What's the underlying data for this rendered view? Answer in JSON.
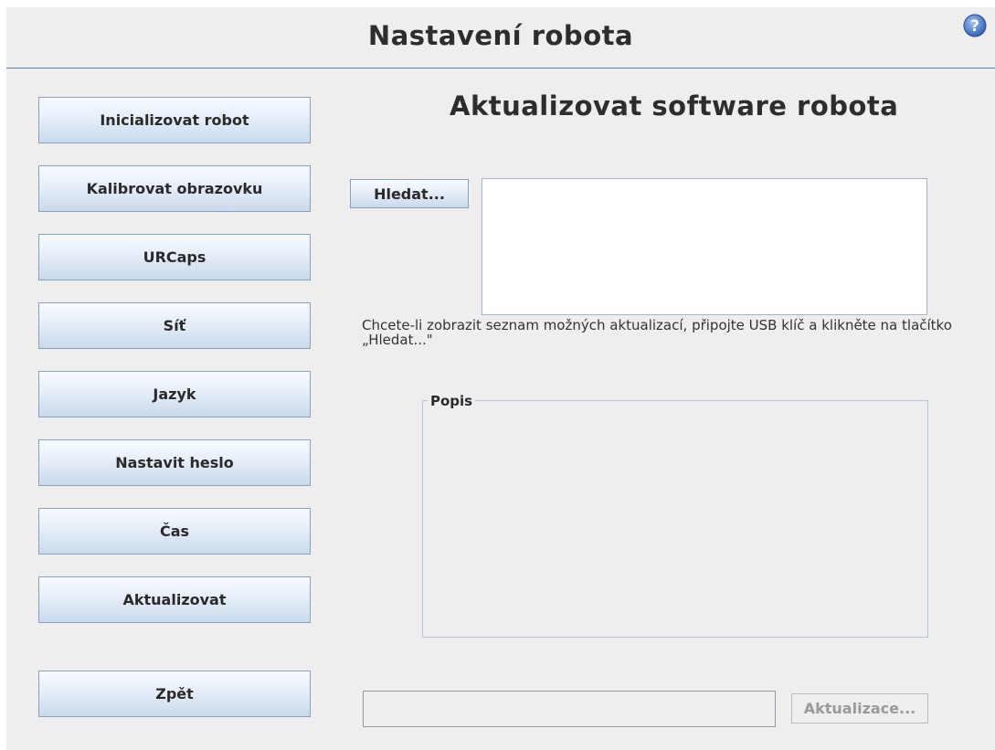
{
  "header": {
    "title": "Nastavení robota",
    "help_icon": "question-circle-icon"
  },
  "sidebar": {
    "items": [
      {
        "label": "Inicializovat robot"
      },
      {
        "label": "Kalibrovat obrazovku"
      },
      {
        "label": "URCaps"
      },
      {
        "label": "Síť"
      },
      {
        "label": "Jazyk"
      },
      {
        "label": "Nastavit heslo"
      },
      {
        "label": "Čas"
      },
      {
        "label": "Aktualizovat"
      }
    ],
    "back_label": "Zpět"
  },
  "main": {
    "title": "Aktualizovat software robota",
    "browse_label": "Hledat...",
    "update_list": [],
    "hint": "Chcete-li zobrazit seznam možných aktualizací, připojte USB klíč a klikněte na tlačítko „Hledat...\"",
    "description_label": "Popis",
    "description": "",
    "progress": "",
    "update_button_label": "Aktualizace...",
    "update_button_enabled": false
  },
  "colors": {
    "background": "#eeeeee",
    "header_divider": "#5b7fb3",
    "button_gradient_top": "#f7fbff",
    "button_gradient_bottom": "#c9d9ec",
    "help_icon_fill": "#4a78c8",
    "disabled_text": "#9a9a9a"
  }
}
